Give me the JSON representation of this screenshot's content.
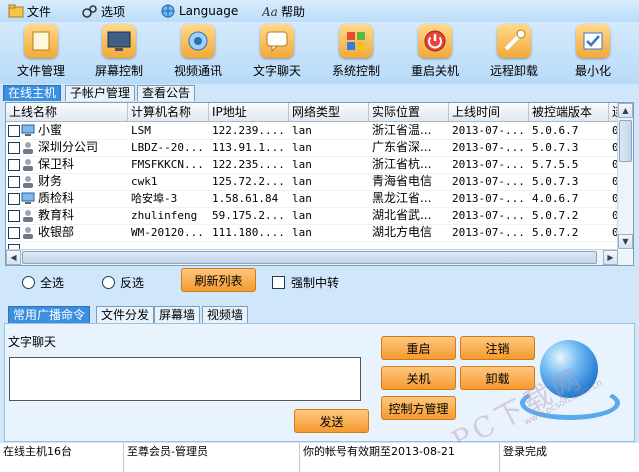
{
  "menubar": {
    "items": [
      {
        "label": "文件",
        "icon": "folder-icon"
      },
      {
        "label": "选项",
        "icon": "options-icon"
      },
      {
        "label": "Language",
        "icon": "globe-icon"
      },
      {
        "label": "帮助",
        "icon": "help-icon"
      }
    ]
  },
  "toolbar": {
    "items": [
      {
        "label": "文件管理",
        "icon": "file-manager-icon"
      },
      {
        "label": "屏幕控制",
        "icon": "screen-control-icon"
      },
      {
        "label": "视频通讯",
        "icon": "video-call-icon"
      },
      {
        "label": "文字聊天",
        "icon": "text-chat-icon"
      },
      {
        "label": "系统控制",
        "icon": "system-control-icon"
      },
      {
        "label": "重启关机",
        "icon": "power-icon"
      },
      {
        "label": "远程卸载",
        "icon": "remote-uninstall-icon"
      },
      {
        "label": "最小化",
        "icon": "minimize-icon"
      }
    ]
  },
  "tabs_top": [
    "在线主机",
    "子帐户管理",
    "查看公告"
  ],
  "grid": {
    "columns": [
      "上线名称",
      "计算机名称",
      "IP地址",
      "网络类型",
      "实际位置",
      "上线时间",
      "被控端版本",
      "连"
    ],
    "rows": [
      [
        "小蜜",
        "LSM",
        "122.239....",
        "lan",
        "浙江省温...",
        "2013-07-...",
        "5.0.6.7",
        "0"
      ],
      [
        "深圳分公司",
        "LBDZ--20...",
        "113.91.1...",
        "lan",
        "广东省深...",
        "2013-07-...",
        "5.0.7.3",
        "0"
      ],
      [
        "保卫科",
        "FMSFKKCN...",
        "122.235....",
        "lan",
        "浙江省杭...",
        "2013-07-...",
        "5.7.5.5",
        "0"
      ],
      [
        "财务",
        "cwk1",
        "125.72.2...",
        "lan",
        "青海省电信",
        "2013-07-...",
        "5.0.7.3",
        "0"
      ],
      [
        "质检科",
        "哈安埠-3",
        "1.58.61.84",
        "lan",
        "黑龙江省...",
        "2013-07-...",
        "4.0.6.7",
        "0"
      ],
      [
        "教育科",
        "zhulinfeng",
        "59.175.2...",
        "lan",
        "湖北省武...",
        "2013-07-...",
        "5.0.7.2",
        "0"
      ],
      [
        "收银部",
        "WM-20120...",
        "111.180....",
        "lan",
        "湖北方电信",
        "2013-07-...",
        "5.0.7.2",
        "0"
      ],
      [
        "",
        "",
        "",
        "",
        "",
        "",
        "",
        ""
      ]
    ]
  },
  "controls": {
    "select_all": "全选",
    "invert": "反选",
    "refresh": "刷新列表",
    "force_relay": "强制中转"
  },
  "tabs_bottom": [
    "常用广播命令",
    "文件分发",
    "屏幕墙",
    "视频墙"
  ],
  "panel": {
    "chat_label": "文字聊天",
    "send": "发送",
    "restart": "重启",
    "logout": "注销",
    "shutdown": "关机",
    "uninstall": "卸载",
    "control_admin": "控制方管理"
  },
  "status": {
    "online": "在线主机16台",
    "member": "至尊会员-管理员",
    "expiry": "你的帐号有效期至2013-08-21",
    "login": "登录完成"
  },
  "watermark": {
    "main": "PC下载网",
    "sub": "www.pcsoft.com.cn"
  },
  "colors": {
    "accent": "#3a8fe0",
    "button_orange": "#f49a2f",
    "background": "#cfe6fb"
  }
}
